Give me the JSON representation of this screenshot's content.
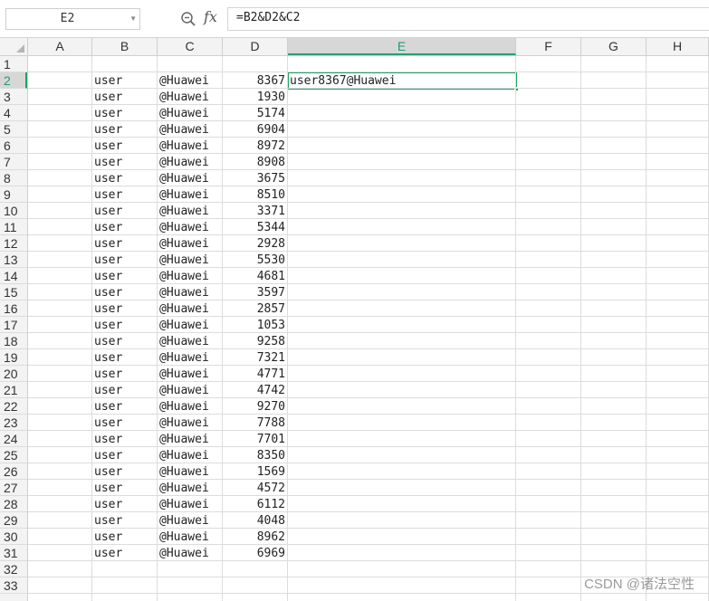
{
  "formula_bar": {
    "name_box": "E2",
    "name_box_caret_icon": "chevron-down-icon",
    "zoom_icon": "zoom-formula-icon",
    "fx_label": "fx",
    "formula": "=B2&D2&C2"
  },
  "colors": {
    "selection_accent": "#21a366",
    "header_background": "#f3f3f3",
    "gridline": "#dcdcdc"
  },
  "columns": [
    "A",
    "B",
    "C",
    "D",
    "E",
    "F",
    "G",
    "H"
  ],
  "selected_column": "E",
  "rows": [
    "1",
    "2",
    "3",
    "4",
    "5",
    "6",
    "7",
    "8",
    "9",
    "10",
    "11",
    "12",
    "13",
    "14",
    "15",
    "16",
    "17",
    "18",
    "19",
    "20",
    "21",
    "22",
    "23",
    "24",
    "25",
    "26",
    "27",
    "28",
    "29",
    "30",
    "31",
    "32",
    "33"
  ],
  "selected_row": "2",
  "active_cell": {
    "ref": "E2",
    "value": "user8367@Huawei"
  },
  "data_rows": [
    {
      "row": "2",
      "b": "user",
      "c": "@Huawei",
      "d": "8367"
    },
    {
      "row": "3",
      "b": "user",
      "c": "@Huawei",
      "d": "1930"
    },
    {
      "row": "4",
      "b": "user",
      "c": "@Huawei",
      "d": "5174"
    },
    {
      "row": "5",
      "b": "user",
      "c": "@Huawei",
      "d": "6904"
    },
    {
      "row": "6",
      "b": "user",
      "c": "@Huawei",
      "d": "8972"
    },
    {
      "row": "7",
      "b": "user",
      "c": "@Huawei",
      "d": "8908"
    },
    {
      "row": "8",
      "b": "user",
      "c": "@Huawei",
      "d": "3675"
    },
    {
      "row": "9",
      "b": "user",
      "c": "@Huawei",
      "d": "8510"
    },
    {
      "row": "10",
      "b": "user",
      "c": "@Huawei",
      "d": "3371"
    },
    {
      "row": "11",
      "b": "user",
      "c": "@Huawei",
      "d": "5344"
    },
    {
      "row": "12",
      "b": "user",
      "c": "@Huawei",
      "d": "2928"
    },
    {
      "row": "13",
      "b": "user",
      "c": "@Huawei",
      "d": "5530"
    },
    {
      "row": "14",
      "b": "user",
      "c": "@Huawei",
      "d": "4681"
    },
    {
      "row": "15",
      "b": "user",
      "c": "@Huawei",
      "d": "3597"
    },
    {
      "row": "16",
      "b": "user",
      "c": "@Huawei",
      "d": "2857"
    },
    {
      "row": "17",
      "b": "user",
      "c": "@Huawei",
      "d": "1053"
    },
    {
      "row": "18",
      "b": "user",
      "c": "@Huawei",
      "d": "9258"
    },
    {
      "row": "19",
      "b": "user",
      "c": "@Huawei",
      "d": "7321"
    },
    {
      "row": "20",
      "b": "user",
      "c": "@Huawei",
      "d": "4771"
    },
    {
      "row": "21",
      "b": "user",
      "c": "@Huawei",
      "d": "4742"
    },
    {
      "row": "22",
      "b": "user",
      "c": "@Huawei",
      "d": "9270"
    },
    {
      "row": "23",
      "b": "user",
      "c": "@Huawei",
      "d": "7788"
    },
    {
      "row": "24",
      "b": "user",
      "c": "@Huawei",
      "d": "7701"
    },
    {
      "row": "25",
      "b": "user",
      "c": "@Huawei",
      "d": "8350"
    },
    {
      "row": "26",
      "b": "user",
      "c": "@Huawei",
      "d": "1569"
    },
    {
      "row": "27",
      "b": "user",
      "c": "@Huawei",
      "d": "4572"
    },
    {
      "row": "28",
      "b": "user",
      "c": "@Huawei",
      "d": "6112"
    },
    {
      "row": "29",
      "b": "user",
      "c": "@Huawei",
      "d": "4048"
    },
    {
      "row": "30",
      "b": "user",
      "c": "@Huawei",
      "d": "8962"
    },
    {
      "row": "31",
      "b": "user",
      "c": "@Huawei",
      "d": "6969"
    }
  ],
  "watermark": "CSDN @诸法空性"
}
